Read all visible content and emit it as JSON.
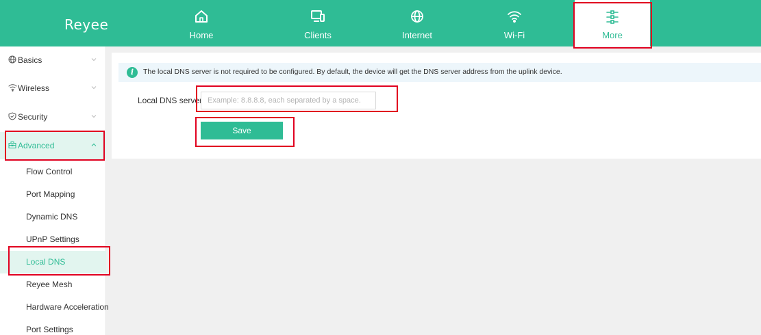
{
  "brand": {
    "logo": "Reyee"
  },
  "nav": [
    {
      "label": "Home",
      "icon": "home-icon"
    },
    {
      "label": "Clients",
      "icon": "clients-icon"
    },
    {
      "label": "Internet",
      "icon": "globe-icon"
    },
    {
      "label": "Wi-Fi",
      "icon": "wifi-icon"
    },
    {
      "label": "More",
      "icon": "sliders-icon",
      "active": true
    }
  ],
  "sidebar": {
    "groups": [
      {
        "label": "Basics",
        "icon": "globe-icon"
      },
      {
        "label": "Wireless",
        "icon": "wifi-icon"
      },
      {
        "label": "Security",
        "icon": "shield-icon"
      },
      {
        "label": "Advanced",
        "icon": "toolbox-icon",
        "open": true
      }
    ],
    "advanced_items": [
      {
        "label": "Flow Control"
      },
      {
        "label": "Port Mapping"
      },
      {
        "label": "Dynamic DNS"
      },
      {
        "label": "UPnP Settings"
      },
      {
        "label": "Local DNS",
        "selected": true
      },
      {
        "label": "Reyee Mesh"
      },
      {
        "label": "Hardware Acceleration"
      },
      {
        "label": "Port Settings"
      }
    ]
  },
  "main": {
    "info_text": "The local DNS server is not required to be configured. By default, the device will get the DNS server address from the uplink device.",
    "field_label": "Local DNS server",
    "field_placeholder": "Example: 8.8.8.8, each separated by a space.",
    "field_value": "",
    "save_label": "Save"
  },
  "colors": {
    "brand": "#2fbc95",
    "highlight": "#e1001f",
    "selected_bg": "#e2f5ef"
  }
}
